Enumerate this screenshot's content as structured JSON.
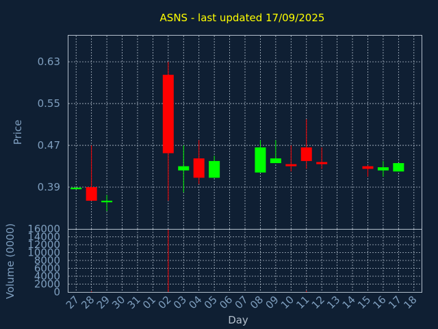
{
  "chart_data": {
    "type": "candlestick",
    "title": "ASNS - last updated 17/09/2025",
    "xlabel": "Day",
    "ylabel_price": "Price",
    "ylabel_volume": "Volume (0000)",
    "categories": [
      "27",
      "28",
      "29",
      "30",
      "31",
      "01",
      "02",
      "03",
      "04",
      "05",
      "06",
      "07",
      "08",
      "09",
      "10",
      "11",
      "12",
      "13",
      "14",
      "15",
      "16",
      "17",
      "18"
    ],
    "price_ylim": [
      0.31,
      0.68
    ],
    "price_ticks": [
      {
        "value": 0.39,
        "label": "0.39"
      },
      {
        "value": 0.47,
        "label": "0.47"
      },
      {
        "value": 0.55,
        "label": "0.55"
      },
      {
        "value": 0.63,
        "label": "0.63"
      }
    ],
    "volume_ylim": [
      0,
      16000
    ],
    "volume_ticks": [
      {
        "value": 0,
        "label": "0"
      },
      {
        "value": 2000,
        "label": "2000"
      },
      {
        "value": 4000,
        "label": "4000"
      },
      {
        "value": 6000,
        "label": "6000"
      },
      {
        "value": 8000,
        "label": "8000"
      },
      {
        "value": 10000,
        "label": "10000"
      },
      {
        "value": 12000,
        "label": "12000"
      },
      {
        "value": 14000,
        "label": "14000"
      },
      {
        "value": 16000,
        "label": "16000"
      }
    ],
    "up_color": "#00ff00",
    "down_color": "#ff0000",
    "candles": [
      {
        "day": "27",
        "open": 0.386,
        "close": 0.389,
        "high": 0.389,
        "low": 0.386
      },
      {
        "day": "28",
        "open": 0.39,
        "close": 0.364,
        "high": 0.47,
        "low": 0.364
      },
      {
        "day": "29",
        "open": 0.361,
        "close": 0.364,
        "high": 0.375,
        "low": 0.344
      },
      {
        "day": "02",
        "open": 0.605,
        "close": 0.455,
        "high": 0.63,
        "low": 0.364
      },
      {
        "day": "03",
        "open": 0.422,
        "close": 0.43,
        "high": 0.47,
        "low": 0.38
      },
      {
        "day": "04",
        "open": 0.445,
        "close": 0.408,
        "high": 0.48,
        "low": 0.396
      },
      {
        "day": "05",
        "open": 0.408,
        "close": 0.44,
        "high": 0.45,
        "low": 0.408
      },
      {
        "day": "08",
        "open": 0.418,
        "close": 0.466,
        "high": 0.48,
        "low": 0.418
      },
      {
        "day": "09",
        "open": 0.436,
        "close": 0.445,
        "high": 0.48,
        "low": 0.436
      },
      {
        "day": "10",
        "open": 0.434,
        "close": 0.43,
        "high": 0.47,
        "low": 0.42
      },
      {
        "day": "11",
        "open": 0.466,
        "close": 0.44,
        "high": 0.52,
        "low": 0.425
      },
      {
        "day": "12",
        "open": 0.438,
        "close": 0.434,
        "high": 0.466,
        "low": 0.425
      },
      {
        "day": "15",
        "open": 0.43,
        "close": 0.425,
        "high": 0.432,
        "low": 0.41
      },
      {
        "day": "16",
        "open": 0.422,
        "close": 0.428,
        "high": 0.44,
        "low": 0.41
      },
      {
        "day": "17",
        "open": 0.42,
        "close": 0.436,
        "high": 0.436,
        "low": 0.42
      }
    ],
    "volume": [
      {
        "day": "28",
        "value": 200,
        "color": "#ff0000"
      },
      {
        "day": "02",
        "value": 15800,
        "color": "#ff0000"
      },
      {
        "day": "11",
        "value": 300,
        "color": "#ff0000"
      }
    ]
  }
}
